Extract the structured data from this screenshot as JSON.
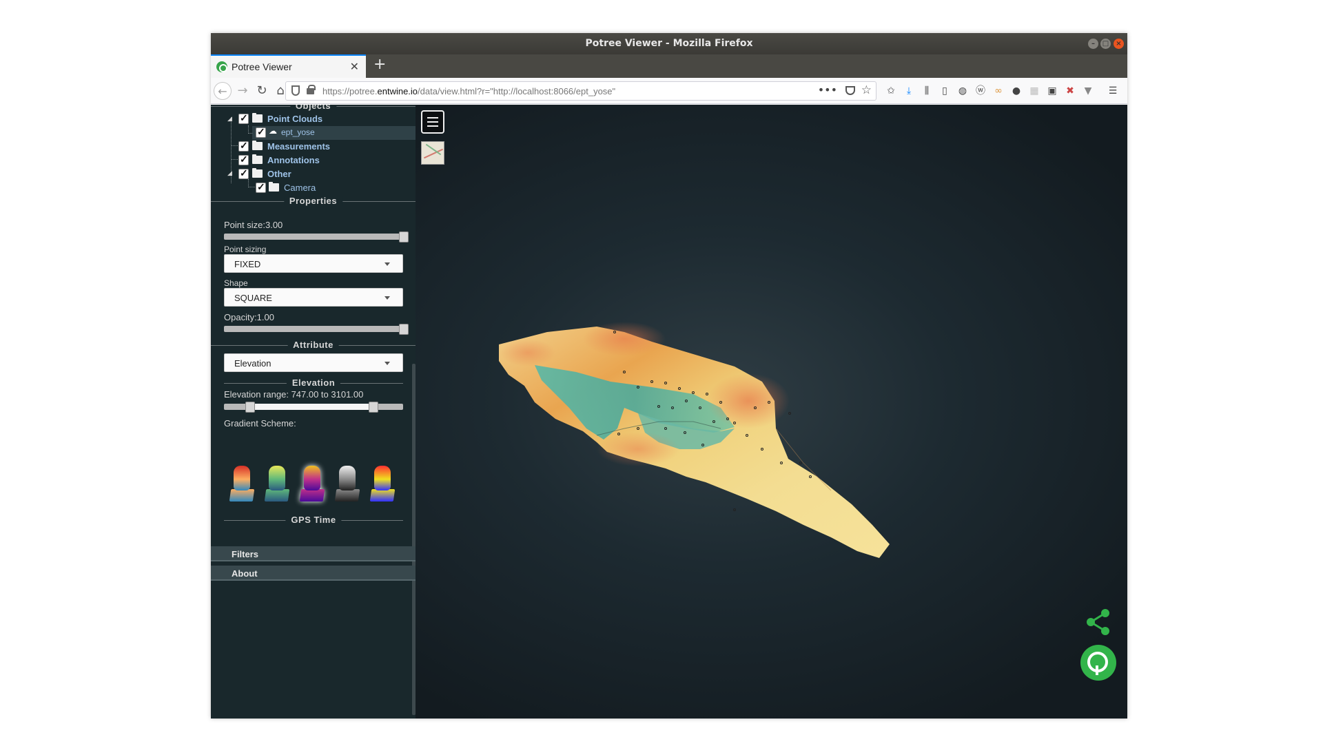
{
  "window": {
    "title": "Potree Viewer - Mozilla Firefox"
  },
  "tab": {
    "title": "Potree Viewer",
    "close_glyph": "✕",
    "new_tab_glyph": "+"
  },
  "navbar": {
    "url_prefix": "https://potree.",
    "url_domain": "entwine.io",
    "url_rest": "/data/view.html?r=\"http://localhost:8066/ept_yose\"",
    "more_glyph": "•••",
    "icons": [
      "back-icon",
      "forward-icon",
      "reload-icon",
      "home-icon",
      "shield-icon",
      "lock-icon",
      "pocket-icon",
      "bookmark-star-icon",
      "downloads-icon",
      "library-icon",
      "sidebar-icon",
      "extension-icons",
      "hamburger-menu-icon"
    ]
  },
  "sidebar": {
    "objects_header": "Objects",
    "tree": {
      "point_clouds": "Point Clouds",
      "ept_yose": "ept_yose",
      "measurements": "Measurements",
      "annotations": "Annotations",
      "other": "Other",
      "camera": "Camera"
    },
    "properties_header": "Properties",
    "point_size_label": "Point size:3.00",
    "point_size_value": 3.0,
    "point_sizing_label": "Point sizing",
    "point_sizing_value": "FIXED",
    "shape_label": "Shape",
    "shape_value": "SQUARE",
    "opacity_label": "Opacity:1.00",
    "opacity_value": 1.0,
    "attribute_header": "Attribute",
    "attribute_value": "Elevation",
    "elevation_header": "Elevation",
    "elevation_range_label": "Elevation range: 747.00 to 3101.00",
    "elevation_min": 747.0,
    "elevation_max": 3101.0,
    "gradient_scheme_label": "Gradient Scheme:",
    "gradient_schemes": [
      {
        "name": "spectral",
        "colors": [
          "#d73027",
          "#fdae61",
          "#3288bd"
        ]
      },
      {
        "name": "yellow-green",
        "colors": [
          "#e8e85a",
          "#5fb87a",
          "#2a5a80"
        ]
      },
      {
        "name": "plasma",
        "colors": [
          "#f0c020",
          "#c0308a",
          "#4a0a9a"
        ],
        "selected": true
      },
      {
        "name": "grayscale",
        "colors": [
          "#f0f0f0",
          "#8a8a8a",
          "#222222"
        ]
      },
      {
        "name": "rainbow",
        "colors": [
          "#ff3030",
          "#f0e020",
          "#3030ff"
        ]
      }
    ],
    "gps_time_header": "GPS Time",
    "filters_label": "Filters",
    "about_label": "About"
  },
  "colors": {
    "sidebar_bg": "#19282c",
    "tree_label": "#9fc3e8",
    "accent_green": "#32b44a"
  }
}
